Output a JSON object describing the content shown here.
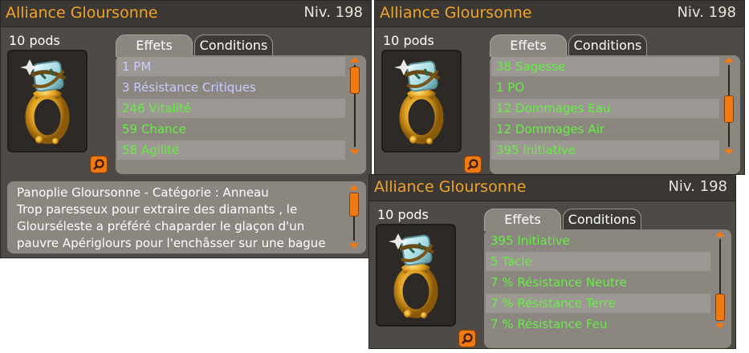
{
  "colors": {
    "accent_orange": "#f0a42a",
    "effect_green": "#66ee44",
    "effect_blue": "#c8cbff"
  },
  "panel_left": {
    "title": "Alliance Gloursonne",
    "level": "Niv. 198",
    "pods": "10 pods",
    "zoom_icon": "magnifier-icon",
    "tabs": [
      {
        "label": "Effets",
        "active": true
      },
      {
        "label": "Conditions",
        "active": false
      }
    ],
    "effects": [
      {
        "text": "1 PM",
        "color": "blue"
      },
      {
        "text": "3 Résistance Critiques",
        "color": "blue"
      },
      {
        "text": "246 Vitalité",
        "color": "green"
      },
      {
        "text": "59 Chance",
        "color": "green"
      },
      {
        "text": "58 Agilité",
        "color": "green"
      }
    ],
    "description": [
      "Panoplie Gloursonne - Catégorie : Anneau",
      "Trop paresseux pour extraire des diamants , le",
      "Glourséleste a préféré chaparder le glaçon d'un",
      "pauvre Apériglours pour l'enchâsser sur une bague"
    ]
  },
  "panel_right_top": {
    "title": "Alliance Gloursonne",
    "level": "Niv. 198",
    "pods": "10 pods",
    "zoom_icon": "magnifier-icon",
    "tabs": [
      {
        "label": "Effets",
        "active": true
      },
      {
        "label": "Conditions",
        "active": false
      }
    ],
    "effects": [
      {
        "text": "38 Sagesse",
        "color": "green"
      },
      {
        "text": "1 PO",
        "color": "green"
      },
      {
        "text": "12 Dommages Eau",
        "color": "green"
      },
      {
        "text": "12 Dommages Air",
        "color": "green"
      },
      {
        "text": "395 Initiative",
        "color": "green"
      }
    ]
  },
  "panel_right_bottom": {
    "title": "Alliance Gloursonne",
    "level": "Niv. 198",
    "pods": "10 pods",
    "zoom_icon": "magnifier-icon",
    "tabs": [
      {
        "label": "Effets",
        "active": true
      },
      {
        "label": "Conditions",
        "active": false
      }
    ],
    "effects": [
      {
        "text": "395 Initiative",
        "color": "green"
      },
      {
        "text": "5 Tacle",
        "color": "green"
      },
      {
        "text": "7 % Résistance Neutre",
        "color": "green"
      },
      {
        "text": "7 % Résistance Terre",
        "color": "green"
      },
      {
        "text": "7 % Résistance Feu",
        "color": "green"
      }
    ]
  }
}
